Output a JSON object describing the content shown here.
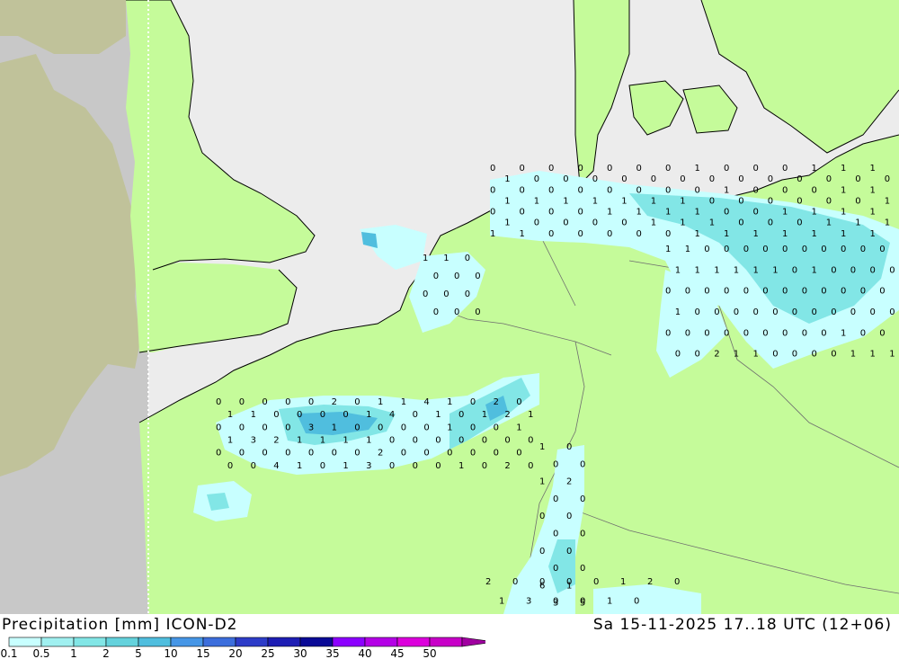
{
  "title": "Precipitation [mm]",
  "model": "ICON-D2",
  "valid_time": "Sa 15-11-2025 17..18 UTC (12+06)",
  "legend": {
    "ticks": [
      "0.1",
      "0.5",
      "1",
      "2",
      "5",
      "10",
      "15",
      "20",
      "25",
      "30",
      "35",
      "40",
      "45",
      "50"
    ],
    "colors": [
      "#c8ffff",
      "#a0f0f0",
      "#82e6e6",
      "#64d2dc",
      "#50bede",
      "#4696e6",
      "#3c6edc",
      "#2d3cc8",
      "#1e1eb4",
      "#0a0a96",
      "#8c00ff",
      "#b400e6",
      "#dc00dc",
      "#c800c8",
      "#a000a0"
    ]
  },
  "colors": {
    "land": "#c5fb9a",
    "sea": "#ececec",
    "outside_domain": "#c8c8c8",
    "outside_land": "#c0c29a",
    "precip_light": "#c8ffff",
    "precip_mid": "#82e6e6",
    "precip_heavy": "#50bede"
  },
  "station_values": [
    "0",
    "0",
    "0",
    "0",
    "0",
    "0",
    "0",
    "1",
    "0",
    "0",
    "0",
    "1",
    "1",
    "1",
    "1",
    "0",
    "0",
    "0",
    "0",
    "0",
    "0",
    "0",
    "0",
    "0",
    "0",
    "0",
    "0",
    "0",
    "0",
    "0",
    "0",
    "0",
    "0",
    "0",
    "0",
    "0",
    "1",
    "0",
    "0",
    "0",
    "1",
    "1",
    "1",
    "1",
    "1",
    "1",
    "1",
    "1",
    "1",
    "0",
    "0",
    "0",
    "0",
    "0",
    "0",
    "1",
    "0",
    "0",
    "0",
    "0",
    "1",
    "1",
    "1",
    "1",
    "0",
    "0",
    "1",
    "1",
    "1",
    "1",
    "1",
    "0",
    "0",
    "0",
    "0",
    "1",
    "1",
    "1",
    "0",
    "0",
    "0",
    "1",
    "1",
    "1",
    "1",
    "1",
    "0",
    "0",
    "0",
    "0",
    "0",
    "1",
    "1",
    "1",
    "1",
    "1",
    "1",
    "1",
    "1",
    "1",
    "0",
    "0",
    "0",
    "0",
    "0",
    "0",
    "0",
    "0",
    "0",
    "0",
    "1",
    "1",
    "1",
    "1",
    "1",
    "1",
    "0",
    "1",
    "0",
    "0",
    "0",
    "0",
    "0",
    "0",
    "0",
    "0",
    "0",
    "0",
    "0",
    "0",
    "0",
    "0",
    "0",
    "0",
    "1",
    "0",
    "0",
    "0",
    "0",
    "0",
    "0",
    "0",
    "0",
    "0",
    "0",
    "0",
    "0",
    "0",
    "0",
    "0",
    "0",
    "0",
    "0",
    "0",
    "0",
    "1",
    "0",
    "0",
    "0",
    "0",
    "2",
    "1",
    "1",
    "0",
    "0",
    "0",
    "0",
    "1",
    "1",
    "1",
    "1",
    "1",
    "0",
    "0",
    "0",
    "0",
    "0",
    "0",
    "0",
    "0",
    "0",
    "0",
    "0",
    "0",
    "0",
    "0",
    "0",
    "2",
    "0",
    "1",
    "1",
    "4",
    "1",
    "0",
    "2",
    "0",
    "1",
    "1",
    "0",
    "0",
    "0",
    "0",
    "1",
    "4",
    "0",
    "1",
    "0",
    "1",
    "2",
    "1",
    "0",
    "0",
    "0",
    "0",
    "3",
    "1",
    "0",
    "0",
    "0",
    "0",
    "1",
    "0",
    "0",
    "1",
    "1",
    "3",
    "2",
    "1",
    "1",
    "1",
    "1",
    "0",
    "0",
    "0",
    "0",
    "0",
    "0",
    "0",
    "0",
    "0",
    "0",
    "0",
    "0",
    "0",
    "0",
    "2",
    "0",
    "0",
    "0",
    "0",
    "0",
    "0",
    "0",
    "0",
    "4",
    "1",
    "0",
    "1",
    "3",
    "0",
    "0",
    "0",
    "1",
    "0",
    "2",
    "0",
    "1",
    "0",
    "0",
    "0",
    "1",
    "2",
    "0",
    "0",
    "0",
    "0",
    "0",
    "0",
    "0",
    "0",
    "0",
    "0",
    "6",
    "1",
    "3",
    "5",
    "2",
    "0",
    "0",
    "0",
    "0",
    "1",
    "2",
    "0",
    "1",
    "3",
    "0",
    "0",
    "1",
    "0"
  ]
}
